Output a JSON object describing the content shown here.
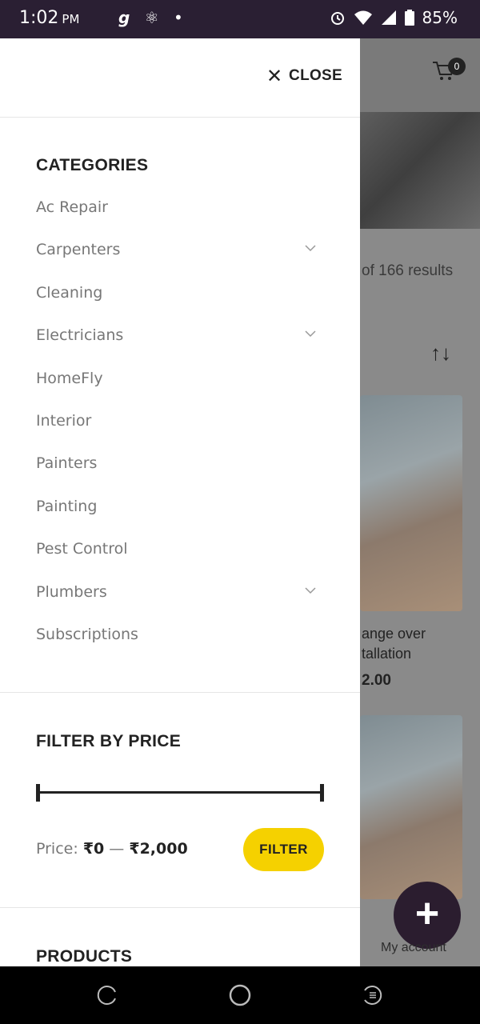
{
  "status_bar": {
    "time": "1:02",
    "ampm": "PM",
    "battery": "85%",
    "left_icons": [
      "g",
      "⚛",
      "•"
    ]
  },
  "background": {
    "results_text": "of 166 results",
    "cart_count": "0",
    "product_title_line1": "ange over",
    "product_title_line2": "tallation",
    "product_price": "2.00",
    "my_account": "My account"
  },
  "drawer": {
    "close_label": "CLOSE",
    "categories_title": "CATEGORIES",
    "categories": [
      {
        "label": "Ac Repair",
        "has_children": false
      },
      {
        "label": "Carpenters",
        "has_children": true
      },
      {
        "label": "Cleaning",
        "has_children": false
      },
      {
        "label": "Electricians",
        "has_children": true
      },
      {
        "label": "HomeFly",
        "has_children": false
      },
      {
        "label": "Interior",
        "has_children": false
      },
      {
        "label": "Painters",
        "has_children": false
      },
      {
        "label": "Painting",
        "has_children": false
      },
      {
        "label": "Pest Control",
        "has_children": false
      },
      {
        "label": "Plumbers",
        "has_children": true
      },
      {
        "label": "Subscriptions",
        "has_children": false
      }
    ],
    "filter_title": "FILTER BY PRICE",
    "price_label": "Price:",
    "price_min": "₹0",
    "price_sep": " — ",
    "price_max": "₹2,000",
    "filter_button": "FILTER",
    "products_title": "PRODUCTS"
  },
  "icons": {
    "close": "close-icon",
    "cart": "cart-icon",
    "chevron": "chevron-down-icon",
    "sort": "sort-icon",
    "add": "plus-icon"
  },
  "colors": {
    "filter_button": "#f5d100",
    "status_bar": "#2a1f33",
    "fab": "#2b1d2f"
  }
}
